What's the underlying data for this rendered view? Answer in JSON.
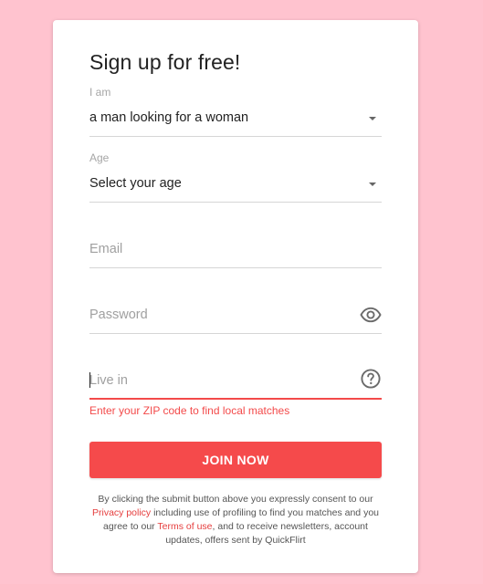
{
  "form": {
    "title": "Sign up for free!",
    "i_am": {
      "label": "I am",
      "value": "a man looking for a woman"
    },
    "age": {
      "label": "Age",
      "value": "Select your age"
    },
    "email": {
      "placeholder": "Email"
    },
    "password": {
      "placeholder": "Password"
    },
    "live_in": {
      "placeholder": "Live in",
      "error": "Enter your ZIP code to find local matches"
    },
    "join_label": "JOIN NOW",
    "consent": {
      "part1": "By clicking the submit button above you expressly consent to our ",
      "privacy_link": "Privacy policy",
      "part2": " including use of profiling to find you matches and you agree to our ",
      "terms_link": "Terms of use",
      "part3": ", and to receive newsletters, account updates, offers sent by QuickFlirt"
    }
  },
  "colors": {
    "background": "#ffc3cf",
    "accent": "#f54a4b",
    "error": "#f34a4a"
  },
  "icons": {
    "dropdown": "caret-down-icon",
    "password_toggle": "eye-icon",
    "help": "question-circle-icon"
  }
}
